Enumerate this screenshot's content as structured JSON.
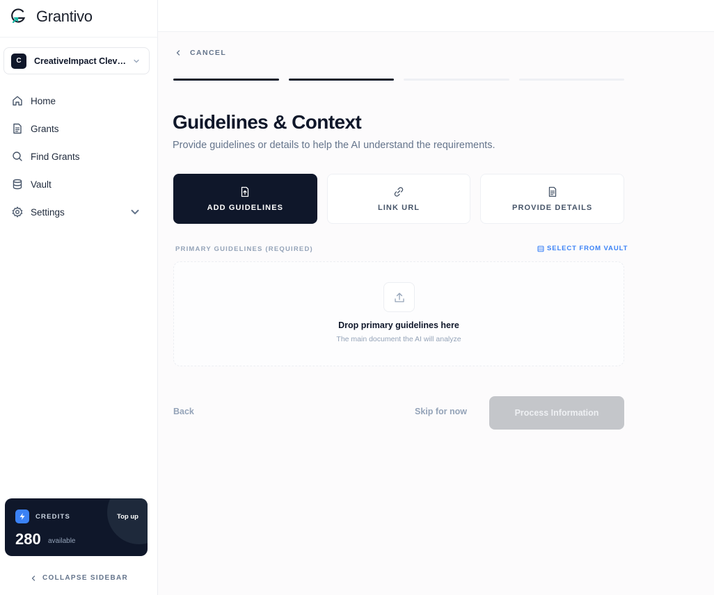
{
  "app": {
    "name": "Grantivo",
    "brand_color": "#0f172a",
    "accent_color": "#3b82f6"
  },
  "sidebar": {
    "org": {
      "initial": "C",
      "name": "CreativeImpact Cleveland"
    },
    "items": [
      {
        "label": "Home",
        "icon": "home-icon"
      },
      {
        "label": "Grants",
        "icon": "document-icon"
      },
      {
        "label": "Find Grants",
        "icon": "search-icon"
      },
      {
        "label": "Vault",
        "icon": "database-icon"
      },
      {
        "label": "Settings",
        "icon": "gear-icon",
        "expandable": true
      }
    ],
    "credits": {
      "label": "CREDITS",
      "value": "280",
      "unit": "available",
      "top_up": "Top up"
    },
    "collapse_label": "COLLAPSE SIDEBAR"
  },
  "main": {
    "cancel_label": "CANCEL",
    "progress": {
      "total_steps": 4,
      "completed_steps": 2
    },
    "title": "Guidelines & Context",
    "subtitle": "Provide guidelines or details to help the AI understand the requirements.",
    "modes": [
      {
        "label": "ADD GUIDELINES",
        "icon": "file-upload-icon",
        "active": true
      },
      {
        "label": "LINK URL",
        "icon": "link-icon",
        "active": false
      },
      {
        "label": "PROVIDE DETAILS",
        "icon": "file-text-icon",
        "active": false
      }
    ],
    "section_label": "PRIMARY GUIDELINES (REQUIRED)",
    "vault_link": "SELECT FROM VAULT",
    "dropzone": {
      "title": "Drop primary guidelines here",
      "subtitle": "The main document the AI will analyze"
    },
    "actions": {
      "back": "Back",
      "skip": "Skip for now",
      "process": "Process Information"
    }
  }
}
